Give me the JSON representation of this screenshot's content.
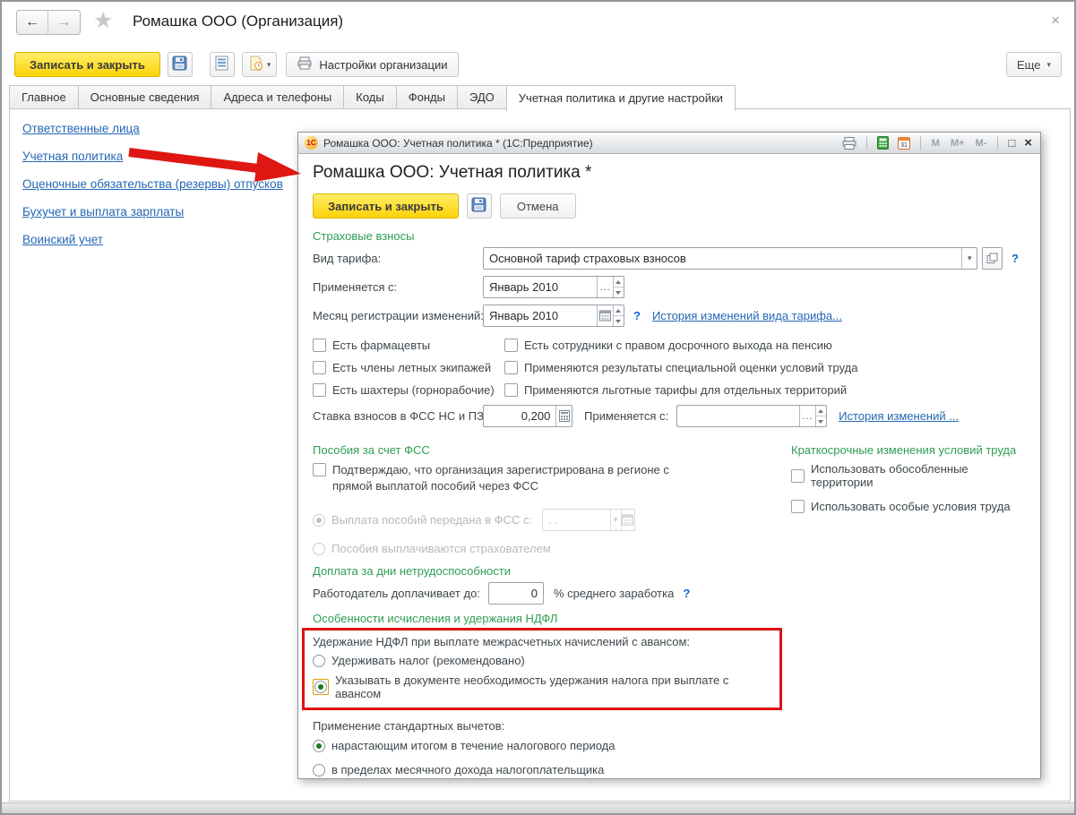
{
  "header": {
    "back_icon": "←",
    "forward_icon": "→",
    "star_icon": "★",
    "title": "Ромашка ООО (Организация)",
    "close_icon": "×"
  },
  "toolbar": {
    "save_close_label": "Записать и закрыть",
    "org_settings_label": "Настройки организации",
    "more_label": "Еще"
  },
  "tabs": [
    {
      "label": "Главное",
      "active": false
    },
    {
      "label": "Основные сведения",
      "active": false
    },
    {
      "label": "Адреса и телефоны",
      "active": false
    },
    {
      "label": "Коды",
      "active": false
    },
    {
      "label": "Фонды",
      "active": false
    },
    {
      "label": "ЭДО",
      "active": false
    },
    {
      "label": "Учетная политика и другие настройки",
      "active": true
    }
  ],
  "sidebar": {
    "links": [
      {
        "label": "Ответственные лица"
      },
      {
        "label": "Учетная политика"
      },
      {
        "label": "Оценочные обязательства (резервы) отпусков"
      },
      {
        "label": "Бухучет и выплата зарплаты"
      },
      {
        "label": "Воинский учет"
      }
    ]
  },
  "dialog": {
    "titlebar": {
      "logo_text": "1С",
      "title": "Ромашка ООО: Учетная политика * (1С:Предприятие)",
      "m": "M",
      "m_plus": "M+",
      "m_minus": "M-",
      "maximize_icon": "□",
      "close_icon": "×"
    },
    "heading": "Ромашка ООО: Учетная политика *",
    "save_close_label": "Записать и закрыть",
    "cancel_label": "Отмена",
    "insurance": {
      "title": "Страховые взносы",
      "tariff_label": "Вид тарифа:",
      "tariff_value": "Основной тариф страховых взносов",
      "applies_label": "Применяется с:",
      "applies_value": "Январь 2010",
      "reg_month_label": "Месяц регистрации изменений:",
      "reg_month_value": "Январь 2010",
      "tariff_history_link": "История изменений вида тарифа...",
      "checkboxes_left": [
        "Есть фармацевты",
        "Есть члены летных экипажей",
        "Есть шахтеры (горнорабочие)"
      ],
      "checkboxes_right": [
        "Есть сотрудники с правом досрочного выхода на пенсию",
        "Применяются результаты специальной оценки условий труда",
        "Применяются льготные тарифы для отдельных территорий"
      ],
      "fss_rate_label": "Ставка взносов в ФСС НС и ПЗ:",
      "fss_rate_value": "0,200",
      "fss_applies_label": "Применяется с:",
      "fss_history_link": "История изменений ..."
    },
    "benefits": {
      "title": "Пособия за счет ФСС",
      "confirm_checkbox": "Подтверждаю, что организация зарегистрирована в регионе с прямой выплатой пособий через ФСС",
      "radio_fss": "Выплата пособий передана в ФСС с:",
      "fss_date_value": ". .",
      "radio_insurer": "Пособия выплачиваются страхователем"
    },
    "short_term": {
      "title": "Краткосрочные изменения условий труда",
      "checkboxes": [
        "Использовать обособленные территории",
        "Использовать особые условия труда"
      ]
    },
    "sick_pay": {
      "title": "Доплата за дни нетрудоспособности",
      "label": "Работодатель доплачивает до:",
      "value": "0",
      "suffix": "% среднего заработка"
    },
    "ndfl": {
      "title": "Особенности исчисления и удержания НДФЛ",
      "group_label": "Удержание НДФЛ при выплате межрасчетных начислений с авансом:",
      "option_withhold": "Удерживать налог (рекомендовано)",
      "option_document": "Указывать в документе необходимость удержания налога при выплате с авансом",
      "selected_option": "option_document"
    },
    "deductions": {
      "label": "Применение стандартных вычетов:",
      "option_cumulative": "нарастающим итогом в течение налогового периода",
      "option_monthly": "в пределах месячного дохода налогоплательщика",
      "selected_option": "option_cumulative"
    }
  },
  "misc": {
    "help_icon": "?",
    "ellipsis": "...",
    "dropdown_arrow": "▾"
  },
  "colors": {
    "accent_yellow": "#fcd20a",
    "section_green": "#2f9d52",
    "link_blue": "#2567b5",
    "highlight_red": "#e01212",
    "radio_selected_green": "#1e7d1e",
    "arrow_red": "#df1712"
  }
}
